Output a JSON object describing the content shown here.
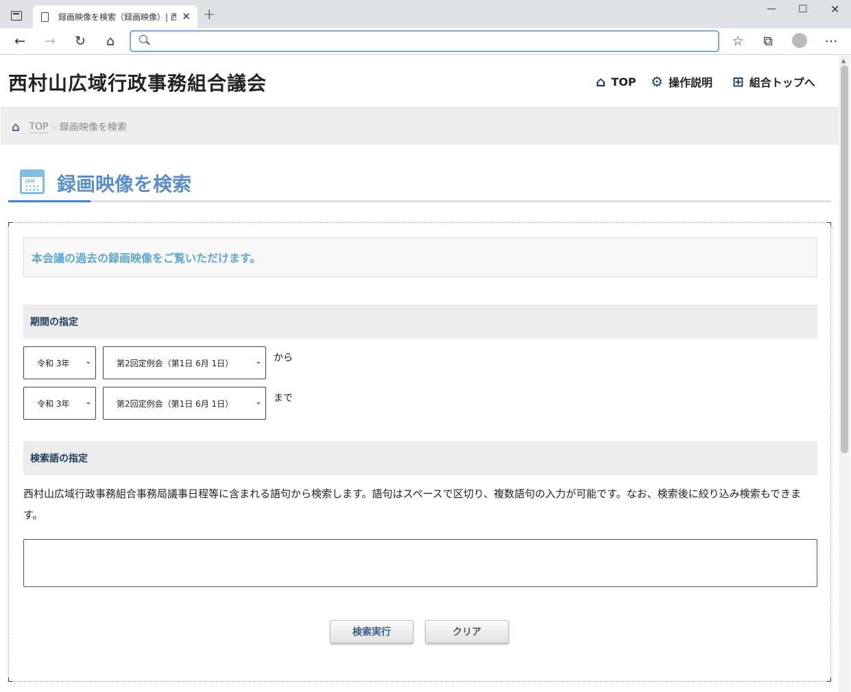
{
  "browser": {
    "tab_title": "録画映像を検索（録画映像）| 西村山広域行政事務組合議会",
    "new_tab_icon": "plus-icon",
    "window_controls": [
      "minimize-icon",
      "maximize-icon",
      "close-icon"
    ],
    "address_placeholder": ""
  },
  "header": {
    "site_title": "西村山広域行政事務組合議会",
    "nav": [
      {
        "label": "TOP",
        "icon": "home-icon"
      },
      {
        "label": "操作説明",
        "icon": "gear-icon"
      },
      {
        "label": "組合トップへ",
        "icon": "sitemap-icon"
      }
    ]
  },
  "breadcrumb": {
    "home_label": "TOP",
    "current": "録画映像を検索"
  },
  "page": {
    "title": "録画映像を検索",
    "calendar_badge": "JAN",
    "intro": "本会議の過去の録画映像をご覧いただけます。"
  },
  "period": {
    "heading": "期間の指定",
    "from": {
      "year": "令和 3年",
      "session": "第2回定例会（第1日 6月 1日）",
      "label": "から"
    },
    "to": {
      "year": "令和 3年",
      "session": "第2回定例会（第1日 6月 1日）",
      "label": "まで"
    }
  },
  "keyword": {
    "heading": "検索語の指定",
    "description": "西村山広域行政事務組合事務局議事日程等に含まれる語句から検索します。語句はスペースで区切り、複数語句の入力が可能です。なお、検索後に絞り込み検索もできます。",
    "value": ""
  },
  "buttons": {
    "search": "検索実行",
    "clear": "クリア"
  },
  "colors": {
    "accent_blue": "#5b8fc9",
    "intro_text": "#5fa7c8",
    "nav_icon": "#1e3a6b"
  }
}
